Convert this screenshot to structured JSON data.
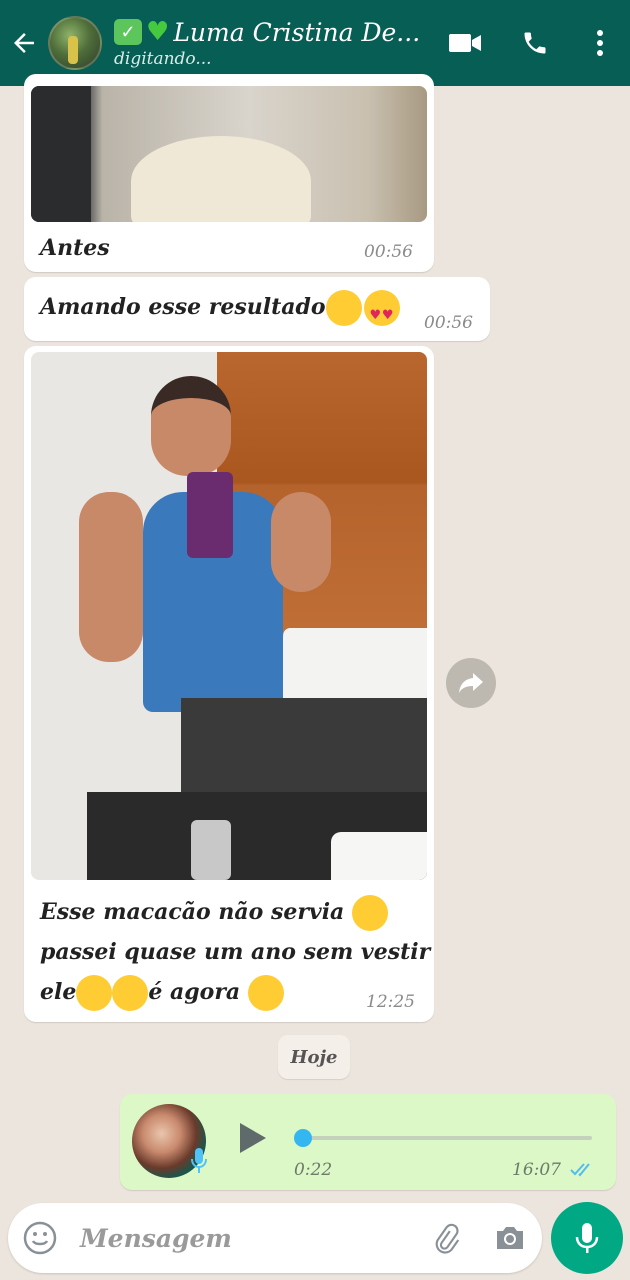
{
  "header": {
    "contact_name": "Luma Cristina De...",
    "status": "digitando..."
  },
  "messages": [
    {
      "caption": "Antes",
      "time": "00:56"
    },
    {
      "text": "Amando esse resultado",
      "time": "00:56"
    },
    {
      "caption": "Esse macacão não servia",
      "caption_line2": "passei quase um ano sem vestir",
      "caption_line3a": "ele",
      "caption_line3b": "é agora",
      "time": "12:25"
    }
  ],
  "date_divider": "Hoje",
  "audio": {
    "duration": "0:22",
    "time": "16:07",
    "progress": 0.0
  },
  "input": {
    "placeholder": "Mensagem"
  },
  "colors": {
    "header": "#075e54",
    "accent": "#00a884",
    "outgoing_bubble": "#dcf8c6",
    "read_ticks": "#53bdeb"
  }
}
